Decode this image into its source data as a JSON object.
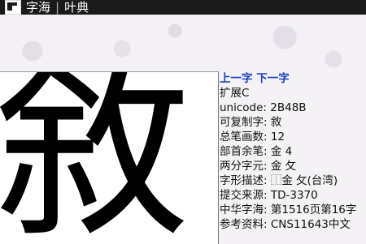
{
  "titlebar": {
    "app": "字海",
    "sub": "叶典",
    "sep": "|"
  },
  "glyph": "敘",
  "nav": {
    "prev": "上一字",
    "next": "下一字"
  },
  "info": [
    {
      "label": "扩展C",
      "value": ""
    },
    {
      "label": "unicode:",
      "value": "2B48B"
    },
    {
      "label": "可复制字:",
      "value": "敘"
    },
    {
      "label": "总笔画数:",
      "value": "12"
    },
    {
      "label": "部首余笔:",
      "value": "金 4"
    },
    {
      "label": "两分字元:",
      "value": "金 攵"
    },
    {
      "label": "字形描述:",
      "value": "⿰金 攵(台湾)"
    },
    {
      "label": "提交来源:",
      "value": "TD-3370"
    },
    {
      "label": "中华字海:",
      "value": "第1516页第16字"
    },
    {
      "label": "参考资料:",
      "value": "CNS11643中文"
    }
  ]
}
